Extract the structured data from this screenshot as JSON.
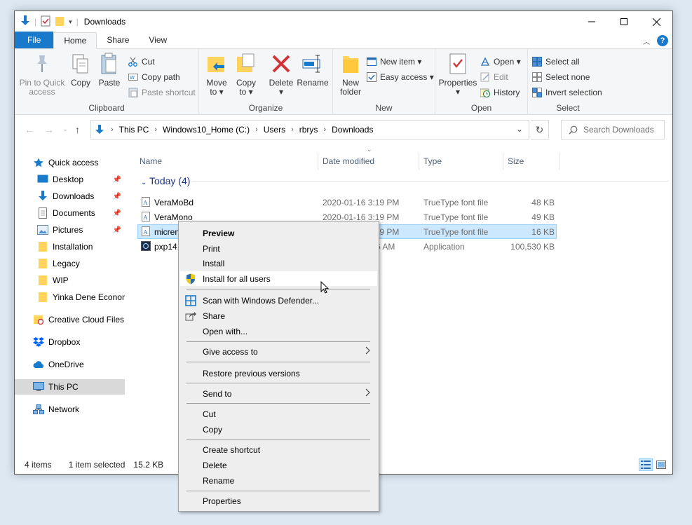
{
  "window": {
    "title": "Downloads"
  },
  "tabs": {
    "file": "File",
    "home": "Home",
    "share": "Share",
    "view": "View"
  },
  "ribbon": {
    "clipboard": {
      "label": "Clipboard",
      "pin_line1": "Pin to Quick",
      "pin_line2": "access",
      "copy": "Copy",
      "paste": "Paste",
      "cut": "Cut",
      "copy_path": "Copy path",
      "paste_shortcut": "Paste shortcut"
    },
    "organize": {
      "label": "Organize",
      "move_line1": "Move",
      "move_line2": "to ▾",
      "copy_line1": "Copy",
      "copy_line2": "to ▾",
      "delete_line1": "Delete",
      "delete_line2": "▾",
      "rename": "Rename"
    },
    "new": {
      "label": "New",
      "folder_line1": "New",
      "folder_line2": "folder",
      "new_item": "New item ▾",
      "easy_access": "Easy access ▾"
    },
    "open": {
      "label": "Open",
      "properties_line1": "Properties",
      "properties_line2": "▾",
      "open": "Open ▾",
      "edit": "Edit",
      "history": "History"
    },
    "select": {
      "label": "Select",
      "select_all": "Select all",
      "select_none": "Select none",
      "invert": "Invert selection"
    }
  },
  "address": {
    "crumbs": [
      "This PC",
      "Windows10_Home (C:)",
      "Users",
      "rbrys",
      "Downloads"
    ],
    "search_placeholder": "Search Downloads"
  },
  "navpane": {
    "items": [
      {
        "label": "Quick access"
      },
      {
        "label": "Desktop"
      },
      {
        "label": "Downloads"
      },
      {
        "label": "Documents"
      },
      {
        "label": "Pictures"
      },
      {
        "label": "Installation"
      },
      {
        "label": "Legacy"
      },
      {
        "label": "WIP"
      },
      {
        "label": "Yinka Dene Econom"
      },
      {
        "label": "Creative Cloud Files"
      },
      {
        "label": "Dropbox"
      },
      {
        "label": "OneDrive"
      },
      {
        "label": "This PC"
      },
      {
        "label": "Network"
      }
    ]
  },
  "files": {
    "columns": {
      "name": "Name",
      "date": "Date modified",
      "type": "Type",
      "size": "Size"
    },
    "group": "Today (4)",
    "rows": [
      {
        "name": "VeraMoBd",
        "date": "2020-01-16 3:19 PM",
        "type": "TrueType font file",
        "size": "48 KB"
      },
      {
        "name": "VeraMono",
        "date": "2020-01-16 3:19 PM",
        "type": "TrueType font file",
        "size": "49 KB"
      },
      {
        "name": "micrenc",
        "date": "2020-01-16 3:19 PM",
        "type": "TrueType font file",
        "size": "16 KB"
      },
      {
        "name": "pxp141",
        "date": "6 AM",
        "type": "Application",
        "size": "100,530 KB"
      }
    ]
  },
  "status": {
    "count": "4 items",
    "selected": "1 item selected",
    "size": "15.2 KB"
  },
  "context_menu": {
    "preview": "Preview",
    "print": "Print",
    "install": "Install",
    "install_all": "Install for all users",
    "scan": "Scan with Windows Defender...",
    "share": "Share",
    "open_with": "Open with...",
    "give_access": "Give access to",
    "restore": "Restore previous versions",
    "send_to": "Send to",
    "cut": "Cut",
    "copy": "Copy",
    "create_shortcut": "Create shortcut",
    "delete": "Delete",
    "rename": "Rename",
    "properties": "Properties"
  }
}
